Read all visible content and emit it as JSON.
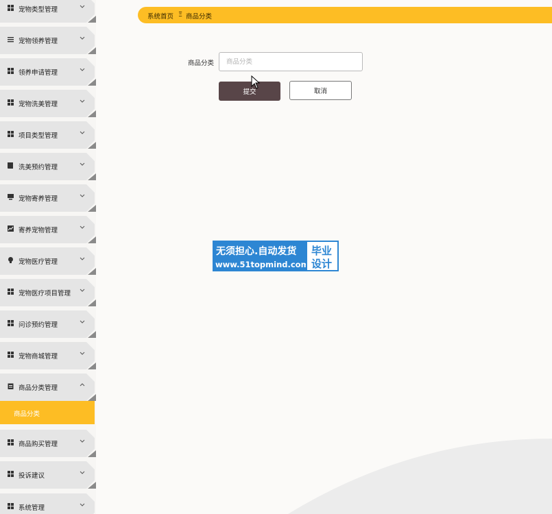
{
  "sidebar": {
    "items": [
      {
        "label": "宠物类型管理",
        "icon": "grid-icon"
      },
      {
        "label": "宠物领养管理",
        "icon": "list-icon"
      },
      {
        "label": "领养申请管理",
        "icon": "grid-icon"
      },
      {
        "label": "宠物洗美管理",
        "icon": "grid-icon"
      },
      {
        "label": "项目类型管理",
        "icon": "grid-icon"
      },
      {
        "label": "洗美预约管理",
        "icon": "book-icon"
      },
      {
        "label": "宠物寄养管理",
        "icon": "monitor-icon"
      },
      {
        "label": "寄养宠物管理",
        "icon": "chart-icon"
      },
      {
        "label": "宠物医疗管理",
        "icon": "bulb-icon"
      },
      {
        "label": "宠物医疗项目管理",
        "icon": "grid-icon"
      },
      {
        "label": "问诊预约管理",
        "icon": "grid-icon"
      },
      {
        "label": "宠物商城管理",
        "icon": "grid-icon"
      },
      {
        "label": "商品分类管理",
        "icon": "clipboard-icon"
      },
      {
        "label": "商品购买管理",
        "icon": "grid-icon"
      },
      {
        "label": "投诉建议",
        "icon": "grid-icon"
      },
      {
        "label": "系统管理",
        "icon": "grid-icon"
      }
    ],
    "active_sub_item": "商品分类"
  },
  "breadcrumb": {
    "home": "系统首页",
    "separator": "Ξ",
    "current": "商品分类"
  },
  "form": {
    "category_label": "商品分类",
    "category_placeholder": "商品分类",
    "category_value": "",
    "submit_label": "提交",
    "cancel_label": "取消"
  },
  "watermark": {
    "line1": "无须担心.自动发货",
    "line2": "www.51topmind.com",
    "right_line1": "毕业",
    "right_line2": "设计"
  },
  "colors": {
    "accent": "#fdbd24",
    "submit_button": "#584548",
    "sidebar_item_bg": "#e5e5e5",
    "watermark_blue": "#2d86d3"
  }
}
